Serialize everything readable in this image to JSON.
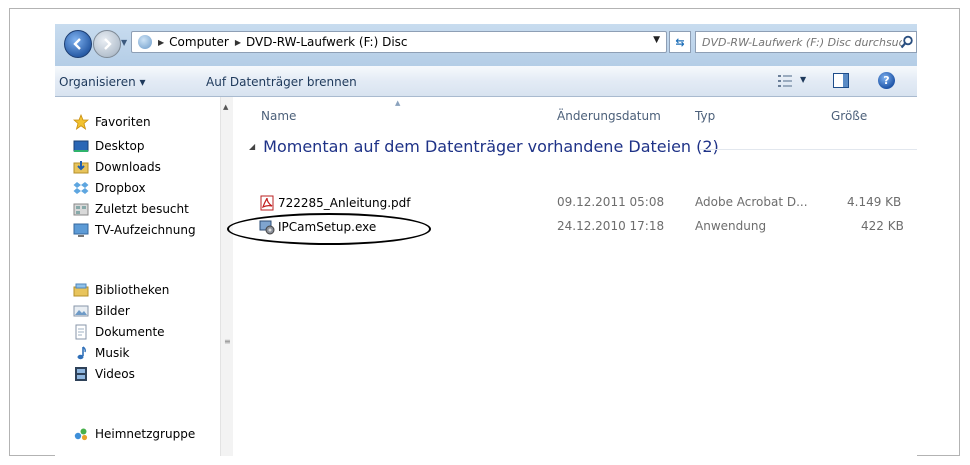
{
  "address": {
    "breadcrumbs": [
      "Computer",
      "DVD-RW-Laufwerk (F:) Disc"
    ],
    "search_placeholder": "DVD-RW-Laufwerk (F:) Disc durchsuc..."
  },
  "toolbar": {
    "organize_label": "Organisieren ▾",
    "burn_label": "Auf Datenträger brennen"
  },
  "nav": {
    "favorites_label": "Favoriten",
    "favorites": [
      "Desktop",
      "Downloads",
      "Dropbox",
      "Zuletzt besucht",
      "TV-Aufzeichnung"
    ],
    "libraries_label": "Bibliotheken",
    "libraries": [
      "Bilder",
      "Dokumente",
      "Musik",
      "Videos"
    ],
    "homegroup_label": "Heimnetzgruppe"
  },
  "columns": {
    "name": "Name",
    "date": "Änderungsdatum",
    "type": "Typ",
    "size": "Größe"
  },
  "group_header": "Momentan auf dem Datenträger vorhandene Dateien (2)",
  "files": [
    {
      "name": "722285_Anleitung.pdf",
      "date": "09.12.2011 05:08",
      "type": "Adobe Acrobat D...",
      "size": "4.149 KB"
    },
    {
      "name": "IPCamSetup.exe",
      "date": "24.12.2010 17:18",
      "type": "Anwendung",
      "size": "422 KB"
    }
  ],
  "colors": {
    "accent": "#1e395b",
    "group_header": "#1e3287",
    "highlight": "#000000"
  }
}
